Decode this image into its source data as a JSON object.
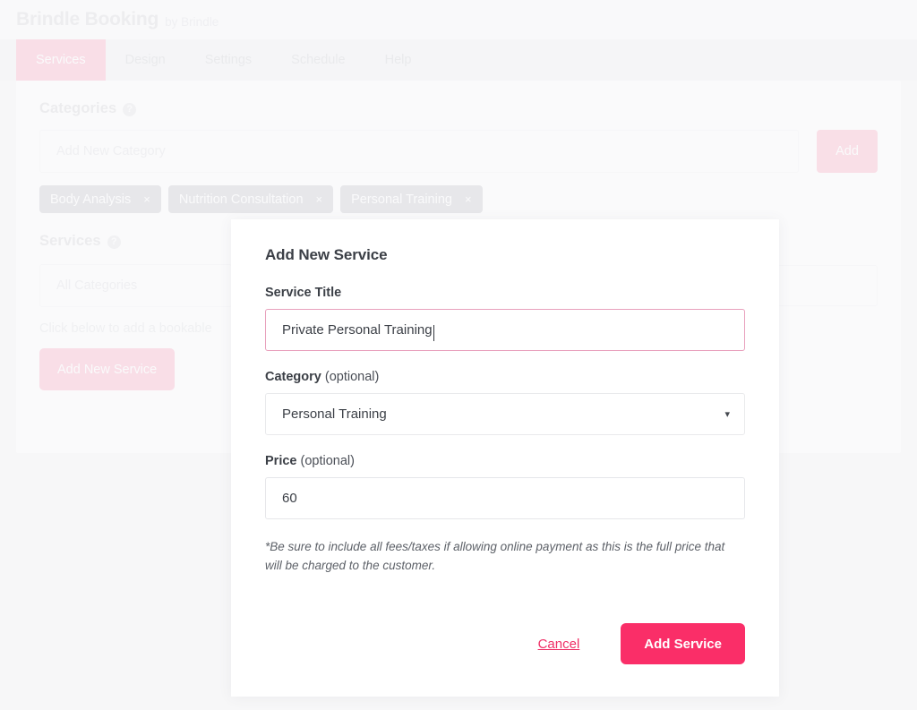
{
  "header": {
    "brand": "Brindle Booking",
    "by": "by Brindle"
  },
  "tabs": [
    {
      "label": "Services",
      "active": true
    },
    {
      "label": "Design",
      "active": false
    },
    {
      "label": "Settings",
      "active": false
    },
    {
      "label": "Schedule",
      "active": false
    },
    {
      "label": "Help",
      "active": false
    }
  ],
  "categories_section": {
    "title": "Categories",
    "help_icon": "question-mark-icon",
    "input_placeholder": "Add New Category",
    "input_value": "",
    "add_label": "Add",
    "chips": [
      {
        "label": "Body Analysis",
        "remove": "×"
      },
      {
        "label": "Nutrition Consultation",
        "remove": "×"
      },
      {
        "label": "Personal Training",
        "remove": "×"
      }
    ]
  },
  "services_section": {
    "title": "Services",
    "help_icon": "question-mark-icon",
    "filter_value": "All Categories",
    "hint": "Click below to add a bookable",
    "add_service_label": "Add New Service"
  },
  "modal": {
    "title": "Add New Service",
    "service_title": {
      "label": "Service Title",
      "value": "Private Personal Training"
    },
    "category": {
      "label": "Category",
      "optional": " (optional)",
      "value": "Personal Training",
      "caret": "▾"
    },
    "price": {
      "label": "Price",
      "optional": " (optional)",
      "value": "60"
    },
    "note": "*Be sure to include all fees/taxes if allowing online payment as this is the full price that will be charged to the customer.",
    "cancel_label": "Cancel",
    "submit_label": "Add Service"
  },
  "colors": {
    "accent": "#fa2e68",
    "accent_muted": "#fbb6ca",
    "link": "#ef2f66",
    "chip": "#cdced3",
    "page_bg": "#f7f7f8",
    "tabbar_bg": "#f1f2f4"
  }
}
